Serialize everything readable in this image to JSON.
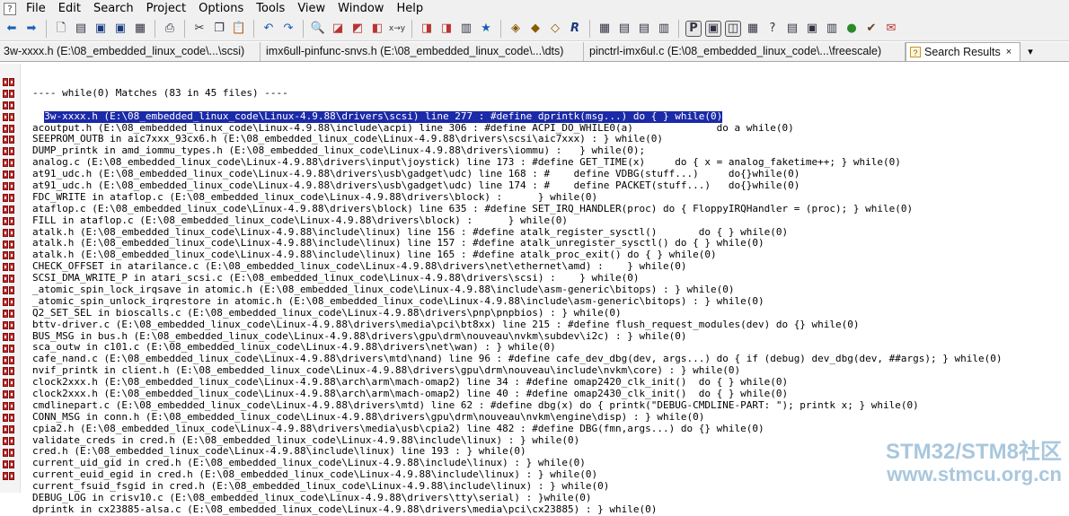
{
  "menu": {
    "items": [
      "File",
      "Edit",
      "Search",
      "Project",
      "Options",
      "Tools",
      "View",
      "Window",
      "Help"
    ]
  },
  "toolbar": {
    "icons": [
      "back-arrow-icon",
      "forward-arrow-icon",
      "new-file-icon",
      "open-file-icon",
      "save-icon",
      "save-all-icon",
      "close-file-icon",
      "print-icon",
      "cut-icon",
      "copy-icon",
      "paste-icon",
      "undo-icon",
      "redo-icon",
      "find-icon",
      "find-in-files-icon",
      "replace-icon",
      "goto-icon",
      "jump-icon",
      "bookmark-icon",
      "bookmark-next-icon",
      "bookmark-prev-icon",
      "window-icon",
      "symbol-icon",
      "reference-icon",
      "relation-icon",
      "r-logo-icon",
      "layout-1-icon",
      "layout-2-icon",
      "layout-3-icon",
      "layout-4-icon",
      "mode-1-icon",
      "mode-2-icon",
      "mode-3-icon",
      "tool-1-icon",
      "tool-2-icon",
      "tool-3-icon",
      "tool-4-icon",
      "tool-5-icon",
      "tool-6-icon",
      "tool-7-icon",
      "tool-8-icon"
    ]
  },
  "tabs": [
    {
      "label": "3w-xxxx.h (E:\\08_embedded_linux_code\\...\\scsi)"
    },
    {
      "label": "imx6ull-pinfunc-snvs.h (E:\\08_embedded_linux_code\\...\\dts)"
    },
    {
      "label": "pinctrl-imx6ul.c (E:\\08_embedded_linux_code\\...\\freescale)"
    },
    {
      "label": "Search Results",
      "close": "×"
    }
  ],
  "results": {
    "header": "---- while(0) Matches (83 in 45 files) ----",
    "lines": [
      "3w-xxxx.h (E:\\08_embedded_linux_code\\Linux-4.9.88\\drivers\\scsi) line 277 : #define dprintk(msg...) do { } while(0)",
      "acoutput.h (E:\\08_embedded_linux_code\\Linux-4.9.88\\include\\acpi) line 306 : #define ACPI_DO_WHILE0(a)              do a while(0)",
      "SEEPROM_OUTB in aic7xxx_93cx6.h (E:\\08_embedded_linux_code\\Linux-4.9.88\\drivers\\scsi\\aic7xxx) : } while(0)",
      "DUMP_printk in amd_iommu_types.h (E:\\08_embedded_linux_code\\Linux-4.9.88\\drivers\\iommu) :   } while(0);",
      "analog.c (E:\\08_embedded_linux_code\\Linux-4.9.88\\drivers\\input\\joystick) line 173 : #define GET_TIME(x)     do { x = analog_faketime++; } while(0)",
      "at91_udc.h (E:\\08_embedded_linux_code\\Linux-4.9.88\\drivers\\usb\\gadget\\udc) line 168 : #    define VDBG(stuff...)     do{}while(0)",
      "at91_udc.h (E:\\08_embedded_linux_code\\Linux-4.9.88\\drivers\\usb\\gadget\\udc) line 174 : #    define PACKET(stuff...)   do{}while(0)",
      "FDC_WRITE in ataflop.c (E:\\08_embedded_linux_code\\Linux-4.9.88\\drivers\\block) :      } while(0)",
      "ataflop.c (E:\\08_embedded_linux_code\\Linux-4.9.88\\drivers\\block) line 635 : #define SET_IRQ_HANDLER(proc) do { FloppyIRQHandler = (proc); } while(0)",
      "FILL in ataflop.c (E:\\08_embedded_linux_code\\Linux-4.9.88\\drivers\\block) :      } while(0)",
      "atalk.h (E:\\08_embedded_linux_code\\Linux-4.9.88\\include\\linux) line 156 : #define atalk_register_sysctl()       do { } while(0)",
      "atalk.h (E:\\08_embedded_linux_code\\Linux-4.9.88\\include\\linux) line 157 : #define atalk_unregister_sysctl() do { } while(0)",
      "atalk.h (E:\\08_embedded_linux_code\\Linux-4.9.88\\include\\linux) line 165 : #define atalk_proc_exit() do { } while(0)",
      "CHECK_OFFSET in atarilance.c (E:\\08_embedded_linux_code\\Linux-4.9.88\\drivers\\net\\ethernet\\amd) :    } while(0)",
      "SCSI_DMA_WRITE_P in atari_scsi.c (E:\\08_embedded_linux_code\\Linux-4.9.88\\drivers\\scsi) :    } while(0)",
      "_atomic_spin_lock_irqsave in atomic.h (E:\\08_embedded_linux_code\\Linux-4.9.88\\include\\asm-generic\\bitops) : } while(0)",
      "_atomic_spin_unlock_irqrestore in atomic.h (E:\\08_embedded_linux_code\\Linux-4.9.88\\include\\asm-generic\\bitops) : } while(0)",
      "Q2_SET_SEL in bioscalls.c (E:\\08_embedded_linux_code\\Linux-4.9.88\\drivers\\pnp\\pnpbios) : } while(0)",
      "bttv-driver.c (E:\\08_embedded_linux_code\\Linux-4.9.88\\drivers\\media\\pci\\bt8xx) line 215 : #define flush_request_modules(dev) do {} while(0)",
      "BUS_MSG in bus.h (E:\\08_embedded_linux_code\\Linux-4.9.88\\drivers\\gpu\\drm\\nouveau\\nvkm\\subdev\\i2c) : } while(0)",
      "sca_outw in c101.c (E:\\08_embedded_linux_code\\Linux-4.9.88\\drivers\\net\\wan) : } while(0)",
      "cafe_nand.c (E:\\08_embedded_linux_code\\Linux-4.9.88\\drivers\\mtd\\nand) line 96 : #define cafe_dev_dbg(dev, args...) do { if (debug) dev_dbg(dev, ##args); } while(0)",
      "nvif_printk in client.h (E:\\08_embedded_linux_code\\Linux-4.9.88\\drivers\\gpu\\drm\\nouveau\\include\\nvkm\\core) : } while(0)",
      "clock2xxx.h (E:\\08_embedded_linux_code\\Linux-4.9.88\\arch\\arm\\mach-omap2) line 34 : #define omap2420_clk_init()  do { } while(0)",
      "clock2xxx.h (E:\\08_embedded_linux_code\\Linux-4.9.88\\arch\\arm\\mach-omap2) line 40 : #define omap2430_clk_init()  do { } while(0)",
      "cmdlinepart.c (E:\\08_embedded_linux_code\\Linux-4.9.88\\drivers\\mtd) line 62 : #define dbg(x) do { printk(\"DEBUG-CMDLINE-PART: \"); printk x; } while(0)",
      "CONN_MSG in conn.h (E:\\08_embedded_linux_code\\Linux-4.9.88\\drivers\\gpu\\drm\\nouveau\\nvkm\\engine\\disp) : } while(0)",
      "cpia2.h (E:\\08_embedded_linux_code\\Linux-4.9.88\\drivers\\media\\usb\\cpia2) line 482 : #define DBG(fmn,args...) do {} while(0)",
      "validate_creds in cred.h (E:\\08_embedded_linux_code\\Linux-4.9.88\\include\\linux) : } while(0)",
      "cred.h (E:\\08_embedded_linux_code\\Linux-4.9.88\\include\\linux) line 193 : } while(0)",
      "current_uid_gid in cred.h (E:\\08_embedded_linux_code\\Linux-4.9.88\\include\\linux) : } while(0)",
      "current_euid_egid in cred.h (E:\\08_embedded_linux_code\\Linux-4.9.88\\include\\linux) : } while(0)",
      "current_fsuid_fsgid in cred.h (E:\\08_embedded_linux_code\\Linux-4.9.88\\include\\linux) : } while(0)",
      "DEBUG_LOG in crisv10.c (E:\\08_embedded_linux_code\\Linux-4.9.88\\drivers\\tty\\serial) : }while(0)",
      "dprintk in cx23885-alsa.c (E:\\08_embedded_linux_code\\Linux-4.9.88\\drivers\\media\\pci\\cx23885) : } while(0)"
    ]
  },
  "watermark": {
    "line1": "STM32/STM8社区",
    "line2": "www.stmcu.org.cn"
  }
}
